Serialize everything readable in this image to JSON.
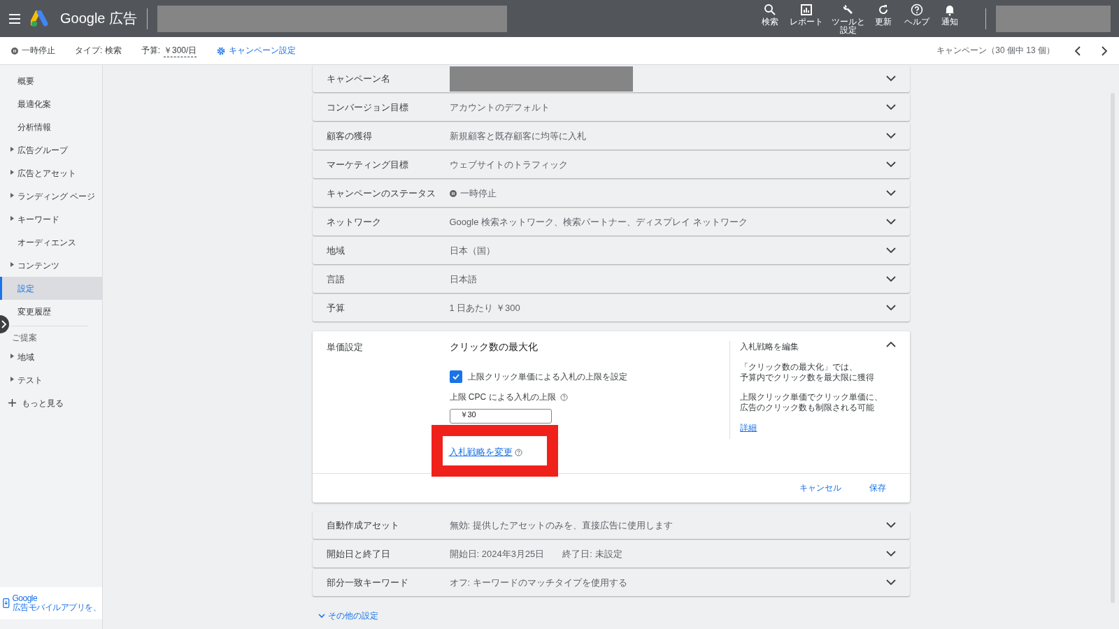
{
  "header": {
    "product": "Google",
    "product_suffix": "広告",
    "tools": [
      {
        "kind": "search",
        "label": "検索"
      },
      {
        "kind": "report",
        "label": "レポート"
      },
      {
        "kind": "tools",
        "label": "ツールと設定"
      },
      {
        "kind": "refresh",
        "label": "更新"
      },
      {
        "kind": "help",
        "label": "ヘルプ"
      },
      {
        "kind": "bell",
        "label": "通知"
      }
    ]
  },
  "subheader": {
    "status": "一時停止",
    "type": "タイプ: 検索",
    "budget_label": "予算:",
    "budget_value": "￥300/日",
    "settings_link": "キャンペーン設定",
    "pager": "キャンペーン（30 個中 13 個）"
  },
  "sidebar": {
    "items": [
      {
        "label": "概要",
        "expandable": false,
        "selected": false
      },
      {
        "label": "最適化案",
        "expandable": false,
        "selected": false
      },
      {
        "label": "分析情報",
        "expandable": false,
        "selected": false
      },
      {
        "label": "広告グループ",
        "expandable": true,
        "selected": false
      },
      {
        "label": "広告とアセット",
        "expandable": true,
        "selected": false
      },
      {
        "label": "ランディング ページ",
        "expandable": true,
        "selected": false
      },
      {
        "label": "キーワード",
        "expandable": true,
        "selected": false
      },
      {
        "label": "オーディエンス",
        "expandable": false,
        "selected": false
      },
      {
        "label": "コンテンツ",
        "expandable": true,
        "selected": false
      },
      {
        "label": "設定",
        "expandable": false,
        "selected": true
      },
      {
        "label": "変更履歴",
        "expandable": false,
        "selected": false
      }
    ],
    "section": "ご提案",
    "section_items": [
      {
        "label": "地域",
        "expandable": true,
        "selected": false
      },
      {
        "label": "テスト",
        "expandable": true,
        "selected": false
      }
    ],
    "more": "もっと見る",
    "footer": {
      "title": "Google",
      "text": "広告モバイルアプリを、"
    }
  },
  "settings_top": [
    {
      "label": "キャンペーン名",
      "kind": "redacted"
    },
    {
      "label": "コンバージョン目標",
      "value": "アカウントのデフォルト",
      "kind": "text"
    },
    {
      "label": "顧客の獲得",
      "value": "新規顧客と既存顧客に均等に入札",
      "kind": "text"
    },
    {
      "label": "マーケティング目標",
      "value": "ウェブサイトのトラフィック",
      "kind": "text"
    },
    {
      "label": "キャンペーンのステータス",
      "value": "一時停止",
      "kind": "status"
    },
    {
      "label": "ネットワーク",
      "value": "Google 検索ネットワーク、検索パートナー、ディスプレイ ネットワーク",
      "kind": "text"
    },
    {
      "label": "地域",
      "value": "日本（国）",
      "kind": "text"
    },
    {
      "label": "言語",
      "value": "日本語",
      "kind": "text"
    },
    {
      "label": "予算",
      "value": "1 日あたり ￥300",
      "kind": "text"
    }
  ],
  "bidding": {
    "label": "単価設定",
    "strategy": "クリック数の最大化",
    "limit_checkbox": {
      "label": "上限クリック単価による入札の上限を設定",
      "checked": true
    },
    "cap_label": "上限 CPC による入札の上限",
    "cap_value": "￥30",
    "change_link": "入札戦略を変更",
    "highlighted": true,
    "side": {
      "title": "入札戦略を編集",
      "paragraphs": [
        [
          "「クリック数の最大化」では、",
          "予算内でクリック数を最大限に獲得"
        ],
        [
          "上限クリック単価でクリック単価に、",
          "広告のクリック数も制限される可能"
        ]
      ],
      "link": "詳細"
    },
    "buttons": [
      "キャンセル",
      "保存"
    ]
  },
  "settings_bottom": [
    {
      "label": "自動作成アセット",
      "value": "無効: 提供したアセットのみを、直接広告に使用します",
      "kind": "text"
    },
    {
      "label": "開始日と終了日",
      "value": "開始日: 2024年3月25日　　終了日: 未設定",
      "kind": "text"
    },
    {
      "label": "部分一致キーワード",
      "value": "オフ: キーワードのマッチタイプを使用する",
      "kind": "text"
    }
  ],
  "more_settings": "その他の設定"
}
